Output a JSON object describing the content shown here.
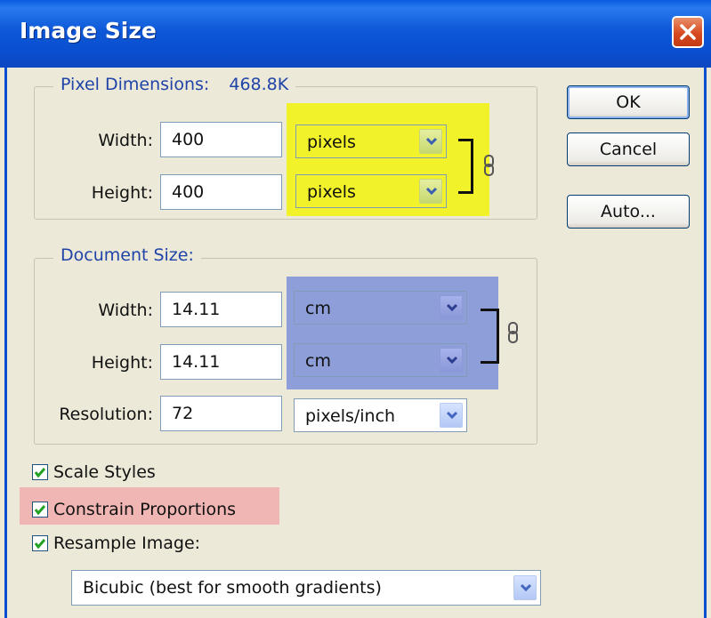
{
  "window": {
    "title": "Image Size"
  },
  "pixel_dimensions": {
    "legend_label": "Pixel Dimensions:",
    "legend_value": "468.8K",
    "width": {
      "label": "Width:",
      "value": "400",
      "unit": "pixels"
    },
    "height": {
      "label": "Height:",
      "value": "400",
      "unit": "pixels"
    }
  },
  "document_size": {
    "legend_label": "Document Size:",
    "width": {
      "label": "Width:",
      "value": "14.11",
      "unit": "cm"
    },
    "height": {
      "label": "Height:",
      "value": "14.11",
      "unit": "cm"
    },
    "resolution": {
      "label": "Resolution:",
      "value": "72",
      "unit": "pixels/inch"
    }
  },
  "options": {
    "scale_styles": {
      "label": "Scale Styles",
      "checked": true
    },
    "constrain_proportions": {
      "label": "Constrain Proportions",
      "checked": true
    },
    "resample_image": {
      "label": "Resample Image:",
      "checked": true
    },
    "resample_method": "Bicubic (best for smooth gradients)"
  },
  "buttons": {
    "ok": "OK",
    "cancel": "Cancel",
    "auto": "Auto..."
  },
  "colors": {
    "highlight_pixels": "#f2f22a",
    "highlight_document": "#8d9ed9",
    "highlight_constrain": "#efb6b4",
    "title_bar": "#0a4fd0"
  },
  "icons": [
    "close-icon",
    "chevron-down-icon",
    "link-icon",
    "checkmark-icon"
  ]
}
